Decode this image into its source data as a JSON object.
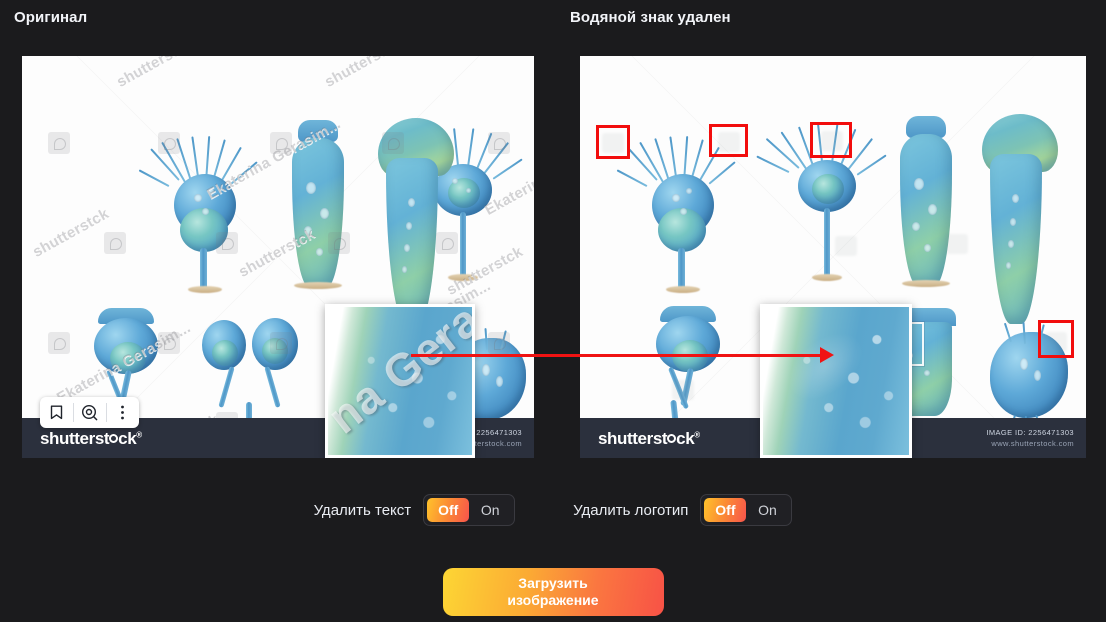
{
  "theme": {
    "background": "#1b1b1d",
    "text_primary": "#f2f4f8",
    "accent_gradient_start": "#fdd634",
    "accent_gradient_end": "#f85246",
    "highlight_box_color": "#f20d0d",
    "arrow_color": "#f01313",
    "footer_bar_color": "#2b303d"
  },
  "panels": {
    "left": {
      "title": "Оригинал",
      "footer": {
        "brand": "shutterst",
        "brand_tail": "ck",
        "trademark": "®",
        "image_id": "2256471303",
        "site": "www.shutterstock.com"
      },
      "toolbar": {
        "bookmark_icon": "bookmark-icon",
        "visual_search_icon": "visual-search-icon",
        "more_icon": "more-options-icon"
      },
      "watermarks": {
        "author": "Ekaterina Gerasim...",
        "brand": "shutterstck",
        "inset_text": "na Geras"
      }
    },
    "right": {
      "title": "Водяной знак удален",
      "footer": {
        "brand": "shutterst",
        "brand_tail": "ck",
        "trademark": "®",
        "id_label": "IMAGE ID:",
        "image_id": "2256471303",
        "site": "www.shutterstock.com"
      }
    }
  },
  "controls": [
    {
      "label": "Удалить текст",
      "name": "remove-text-toggle",
      "options": [
        "Off",
        "On"
      ],
      "selected": "Off"
    },
    {
      "label": "Удалить логотип",
      "name": "remove-logo-toggle",
      "options": [
        "Off",
        "On"
      ],
      "selected": "Off"
    }
  ],
  "cta": {
    "line1": "Загрузить",
    "line2": "изображение"
  }
}
